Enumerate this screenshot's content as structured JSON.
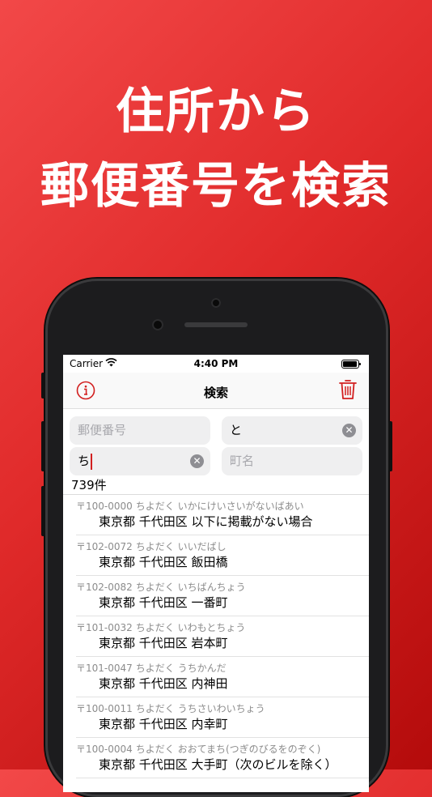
{
  "headline": {
    "line1": "住所から",
    "line2": "郵便番号を検索"
  },
  "status": {
    "carrier": "Carrier",
    "time": "4:40 PM"
  },
  "nav": {
    "title": "検索"
  },
  "fields": {
    "zip_placeholder": "郵便番号",
    "prefecture_value": "と",
    "city_value": "ち",
    "town_placeholder": "町名"
  },
  "result_count": "739件",
  "results": [
    {
      "zip": "〒100-0000",
      "kana": "ちよだく いかにけいさいがないばあい",
      "address": "東京都 千代田区 以下に掲載がない場合"
    },
    {
      "zip": "〒102-0072",
      "kana": "ちよだく いいだばし",
      "address": "東京都 千代田区 飯田橋"
    },
    {
      "zip": "〒102-0082",
      "kana": "ちよだく いちばんちょう",
      "address": "東京都 千代田区 一番町"
    },
    {
      "zip": "〒101-0032",
      "kana": "ちよだく いわもとちょう",
      "address": "東京都 千代田区 岩本町"
    },
    {
      "zip": "〒101-0047",
      "kana": "ちよだく うちかんだ",
      "address": "東京都 千代田区 内神田"
    },
    {
      "zip": "〒100-0011",
      "kana": "ちよだく うちさいわいちょう",
      "address": "東京都 千代田区 内幸町"
    },
    {
      "zip": "〒100-0004",
      "kana": "ちよだく おおてまち(つぎのびるをのぞく)",
      "address": "東京都 千代田区 大手町（次のビルを除く）"
    }
  ],
  "colors": {
    "accent": "#d21f1f",
    "background": "#e02a2a"
  }
}
